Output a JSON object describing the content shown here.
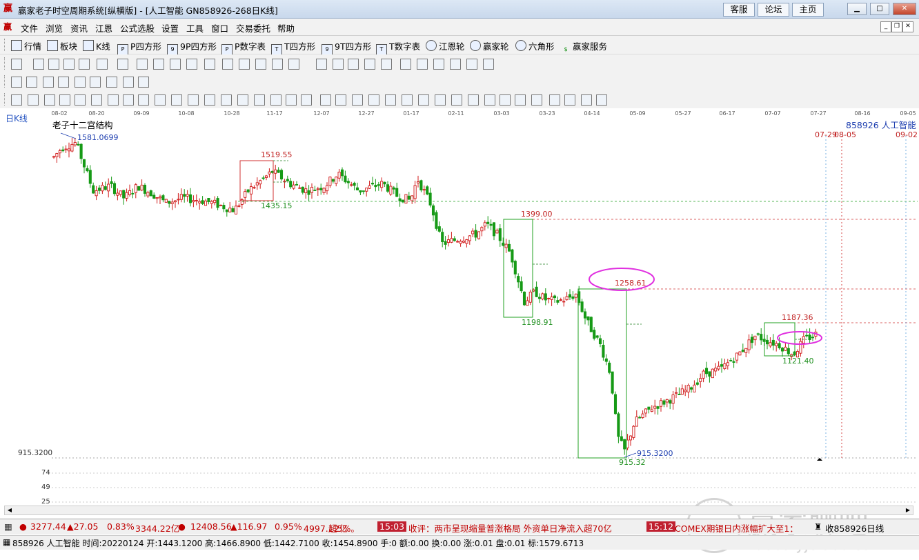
{
  "window": {
    "title": "赢家老子时空周期系统[纵横版] - [人工智能  GN858926-268日K线]",
    "links": [
      "客服",
      "论坛",
      "主页"
    ]
  },
  "menu": [
    "文件",
    "浏览",
    "资讯",
    "江恩",
    "公式选股",
    "设置",
    "工具",
    "窗口",
    "交易委托",
    "帮助"
  ],
  "toolbar1": [
    {
      "label": "行情",
      "icon": "quote-table-icon"
    },
    {
      "label": "板块",
      "icon": "sector-icon"
    },
    {
      "label": "K线",
      "icon": "kline-icon"
    },
    {
      "label": "P四方形",
      "icon": "p-square-icon"
    },
    {
      "label": "9P四方形",
      "icon": "9p-square-icon"
    },
    {
      "label": "P数字表",
      "icon": "pn-table-icon"
    },
    {
      "label": "T四方形",
      "icon": "t-square-icon"
    },
    {
      "label": "9T四方形",
      "icon": "9t-square-icon"
    },
    {
      "label": "T数字表",
      "icon": "tn-table-icon"
    },
    {
      "label": "江恩轮",
      "icon": "gann-wheel-icon"
    },
    {
      "label": "赢家轮",
      "icon": "winner-wheel-icon"
    },
    {
      "label": "六角形",
      "icon": "hexagon-icon"
    },
    {
      "label": "赢家服务",
      "icon": "dollar-icon"
    }
  ],
  "chart": {
    "period_label": "日K线",
    "structure_label": "老子十二宫结构",
    "symbol_label": "858926  人工智能",
    "x_ticks": [
      "08-02",
      "08-20",
      "09-09",
      "10-08",
      "10-28",
      "11-17",
      "12-07",
      "12-27",
      "01-17",
      "02-11",
      "03-03",
      "03-23",
      "04-14",
      "05-09",
      "05-27",
      "06-17",
      "07-07",
      "07-27",
      "08-16",
      "09-05"
    ],
    "future_dates": [
      "07-29",
      "08-05",
      "09-02"
    ],
    "price_labels": {
      "start_low": "1581.0699",
      "high1": "1519.55",
      "low1": "1435.15",
      "high2": "1399.00",
      "low2": "1198.91",
      "high3": "1258.61",
      "bottom": "915.3200",
      "bottom_label": "915.32",
      "high4": "1187.36",
      "low4": "1121.40",
      "axis_bottom": "915.3200"
    },
    "indicator_ticks": [
      "74",
      "49",
      "25"
    ],
    "colors": {
      "up": "#d01818",
      "down": "#169a16",
      "level_red": "#d03030",
      "level_green": "#20a020",
      "ellipse": "#e030e0",
      "cycle_line": "#6aa8e0"
    },
    "watermark": {
      "cn": "赢家聊吧",
      "url": "liaoba.yjcf360.com",
      "seal": "财富赢家"
    }
  },
  "status": {
    "sh_index": "3277.44",
    "sh_change": "▲27.05",
    "sh_pct": "0.83%",
    "sh_amount": "3344.22亿",
    "sz_index": "12408.56",
    "sz_change": "▲116.97",
    "sz_pct": "0.95%",
    "sz_amount": "4997.12亿",
    "news_tail": "超5%。",
    "news1_time": "15:03",
    "news1_text": "收评：两市呈现缩量普涨格局 外资单日净流入超70亿",
    "news2_time": "15:12",
    "news2_text": "COMEX期银日内涨幅扩大至1：",
    "right_label": "收858926日线",
    "bar_info": "858926 人工智能 时间:20220124 开:1443.1200 高:1466.8900 低:1442.7100 收:1454.8900 手:0 额:0.00 换:0.00 涨:0.01 盘:0.01 标:1579.6713"
  }
}
